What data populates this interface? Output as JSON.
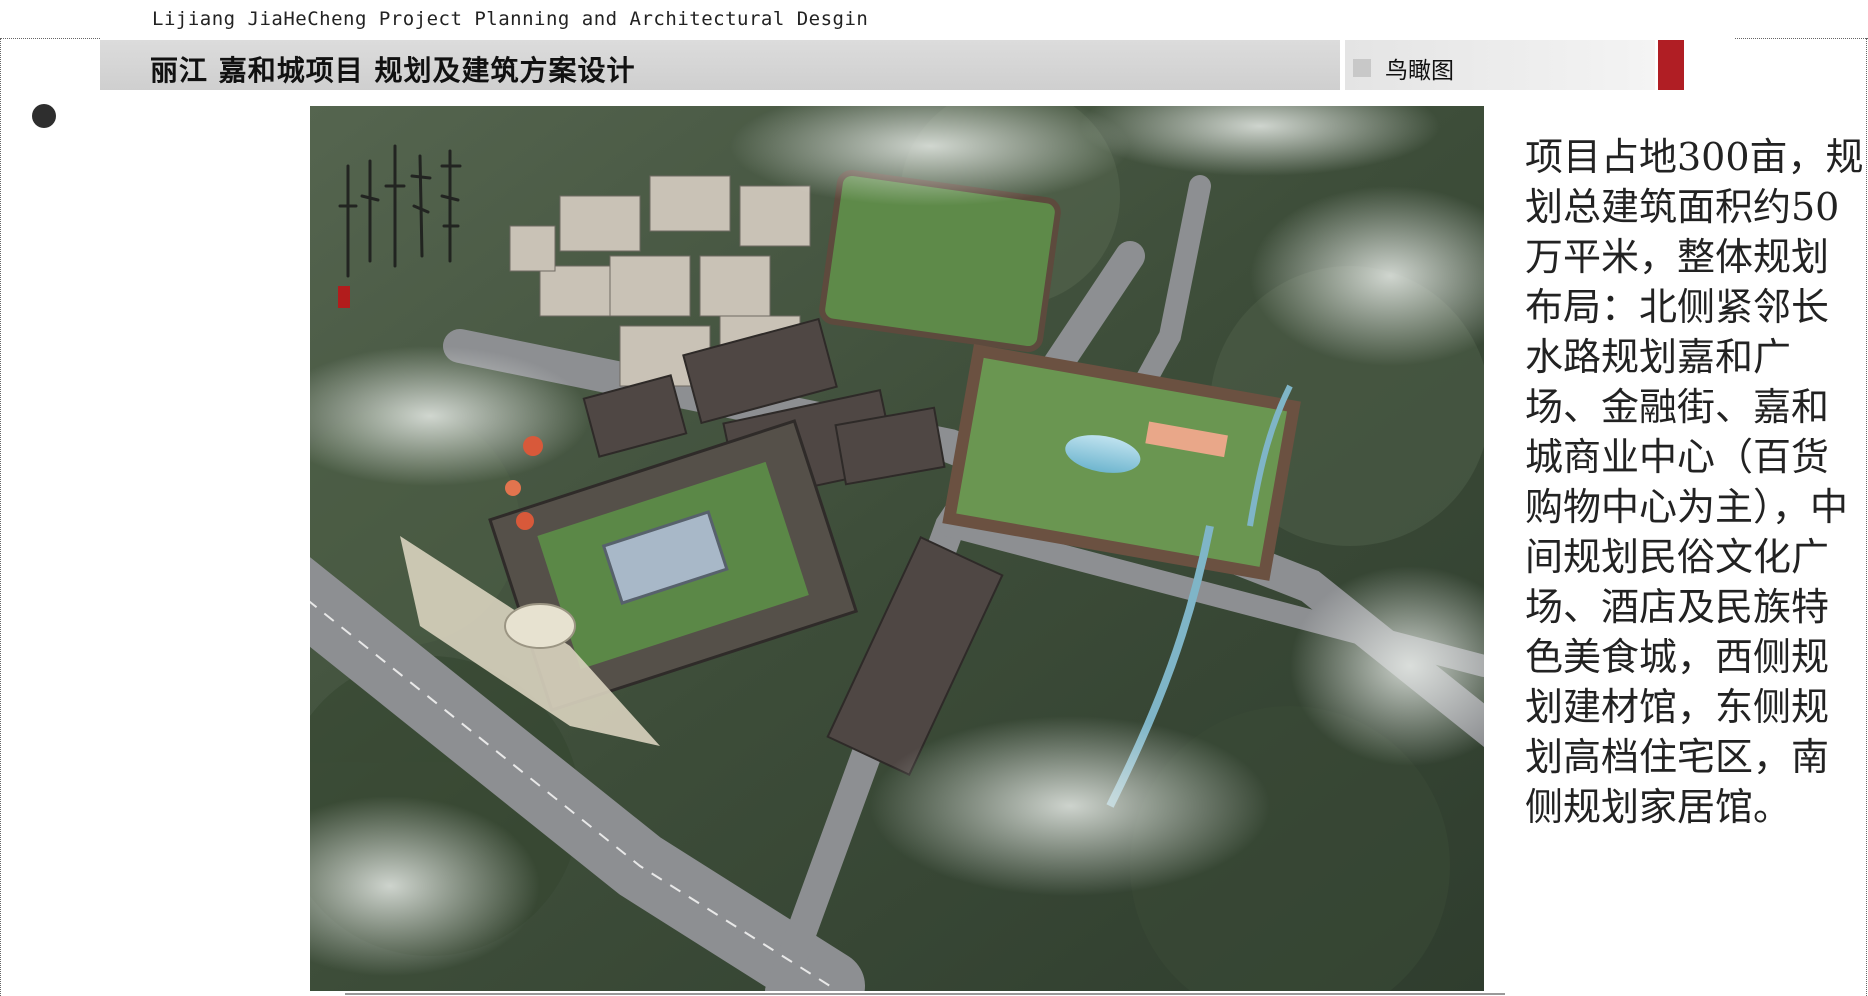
{
  "header": {
    "english_title": "Lijiang JiaHeCheng Project Planning and Architectural Desgin",
    "chinese_title": "丽江  嘉和城项目  规划及建筑方案设计",
    "section_label": "鸟瞰图",
    "accent_color": "#b01e24"
  },
  "image": {
    "calligraphy_icon": "calligraphy-icon",
    "seal_icon": "seal-icon"
  },
  "description": {
    "text": "项目占地300亩，规划总建筑面积约50万平米，整体规划布局：北侧紧邻长水路规划嘉和广场、金融街、嘉和城商业中心（百货购物中心为主），中间规划民俗文化广场、酒店及民族特色美食城，西侧规划建材馆，东侧规划高档住宅区，南侧规划家居馆。"
  }
}
